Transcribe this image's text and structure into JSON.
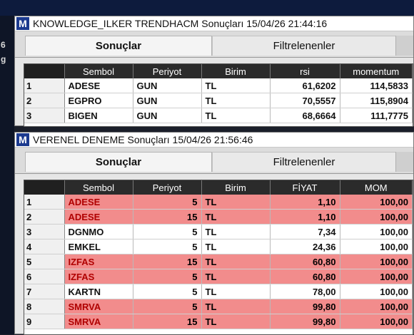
{
  "background": {
    "left_glyphs": [
      "6",
      "g"
    ]
  },
  "panel1": {
    "icon_letter": "M",
    "title": "KNOWLEDGE_ILKER TRENDHACM Sonuçları  15/04/26 21:44:16",
    "tabs": {
      "active": "Sonuçlar",
      "inactive": "Filtrelenenler"
    },
    "columns": [
      "",
      "Sembol",
      "Periyot",
      "Birim",
      "rsi",
      "momentum"
    ],
    "rows": [
      {
        "idx": "1",
        "sembol": "ADESE",
        "periyot": "GUN",
        "birim": "TL",
        "rsi": "61,6202",
        "momentum": "114,5833"
      },
      {
        "idx": "2",
        "sembol": "EGPRO",
        "periyot": "GUN",
        "birim": "TL",
        "rsi": "70,5557",
        "momentum": "115,8904"
      },
      {
        "idx": "3",
        "sembol": "BIGEN",
        "periyot": "GUN",
        "birim": "TL",
        "rsi": "68,6664",
        "momentum": "111,7775"
      }
    ]
  },
  "panel2": {
    "icon_letter": "M",
    "title": "VERENEL DENEME Sonuçları  15/04/26 21:56:46",
    "tabs": {
      "active": "Sonuçlar",
      "inactive": "Filtrelenenler"
    },
    "columns": [
      "",
      "Sembol",
      "Periyot",
      "Birim",
      "FİYAT",
      "MOM"
    ],
    "rows": [
      {
        "idx": "1",
        "sembol": "ADESE",
        "periyot": "5",
        "birim": "TL",
        "fiyat": "1,10",
        "mom": "100,00",
        "highlight": true
      },
      {
        "idx": "2",
        "sembol": "ADESE",
        "periyot": "15",
        "birim": "TL",
        "fiyat": "1,10",
        "mom": "100,00",
        "highlight": true
      },
      {
        "idx": "3",
        "sembol": "DGNMO",
        "periyot": "5",
        "birim": "TL",
        "fiyat": "7,34",
        "mom": "100,00",
        "highlight": false
      },
      {
        "idx": "4",
        "sembol": "EMKEL",
        "periyot": "5",
        "birim": "TL",
        "fiyat": "24,36",
        "mom": "100,00",
        "highlight": false
      },
      {
        "idx": "5",
        "sembol": "IZFAS",
        "periyot": "15",
        "birim": "TL",
        "fiyat": "60,80",
        "mom": "100,00",
        "highlight": true
      },
      {
        "idx": "6",
        "sembol": "IZFAS",
        "periyot": "5",
        "birim": "TL",
        "fiyat": "60,80",
        "mom": "100,00",
        "highlight": true
      },
      {
        "idx": "7",
        "sembol": "KARTN",
        "periyot": "5",
        "birim": "TL",
        "fiyat": "78,00",
        "mom": "100,00",
        "highlight": false
      },
      {
        "idx": "8",
        "sembol": "SMRVA",
        "periyot": "5",
        "birim": "TL",
        "fiyat": "99,80",
        "mom": "100,00",
        "highlight": true
      },
      {
        "idx": "9",
        "sembol": "SMRVA",
        "periyot": "15",
        "birim": "TL",
        "fiyat": "99,80",
        "mom": "100,00",
        "highlight": true
      }
    ]
  },
  "colors": {
    "highlight_row": "#f28c8c",
    "header_bg": "#2b2b2b",
    "icon_blue": "#1c3a8f",
    "symbol_red": "#b00000"
  }
}
